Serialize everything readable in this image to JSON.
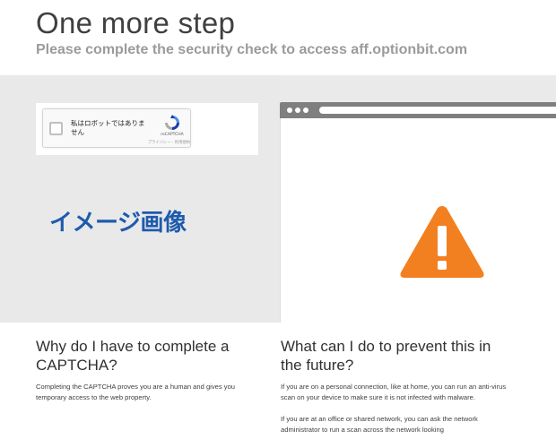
{
  "header": {
    "title": "One more step",
    "subtitle": "Please complete the security check to access aff.optionbit.com"
  },
  "recaptcha": {
    "checkbox_label": "私はロボットではありません",
    "brand": "reCAPTCHA",
    "terms": "プライバシー - 利用規約"
  },
  "image_caption": "イメージ画像",
  "sections": {
    "why": {
      "heading": "Why do I have to complete a CAPTCHA?",
      "body": "Completing the CAPTCHA proves you are a human and gives you temporary access to the web property."
    },
    "prevent": {
      "heading": "What can I do to prevent this in the future?",
      "body_1": "If you are on a personal connection, like at home, you can run an anti-virus scan on your device to make sure it is not infected with malware.",
      "body_2": "If you are at an office or shared network, you can ask the network administrator to run a scan across the network looking"
    }
  },
  "icons": {
    "warning": "warning-triangle-icon",
    "recaptcha": "recaptcha-logo-icon"
  },
  "colors": {
    "warning": "#f38020",
    "caption": "#1e5bad",
    "gray_band": "#eaeaea",
    "browser_bar": "#7f7f7f"
  }
}
